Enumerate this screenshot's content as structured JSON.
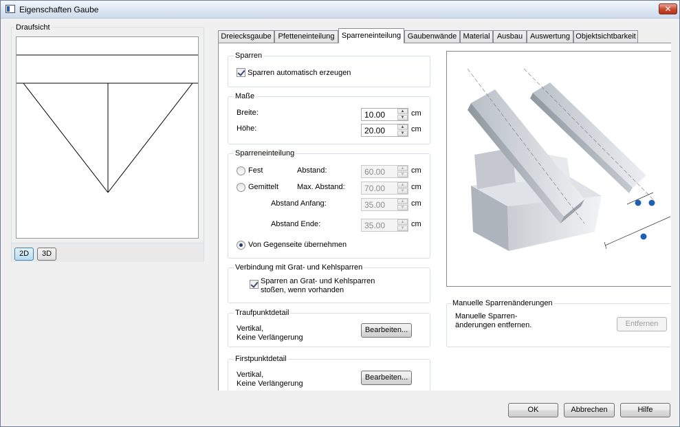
{
  "window": {
    "title": "Eigenschaften Gaube",
    "close_glyph": "✕"
  },
  "left": {
    "group_label": "Draufsicht",
    "btn_2d": "2D",
    "btn_3d": "3D"
  },
  "tabs": [
    {
      "label": "Dreiecksgaube"
    },
    {
      "label": "Pfetteneinteilung"
    },
    {
      "label": "Sparreneinteilung"
    },
    {
      "label": "Gaubenwände"
    },
    {
      "label": "Material"
    },
    {
      "label": "Ausbau"
    },
    {
      "label": "Auswertung"
    },
    {
      "label": "Objektsichtbarkeit"
    }
  ],
  "sparren": {
    "group_label": "Sparren",
    "auto_label": "Sparren automatisch erzeugen",
    "auto_checked": true
  },
  "masse": {
    "group_label": "Maße",
    "breite_label": "Breite:",
    "breite_value": "10.00",
    "hoehe_label": "Höhe:",
    "hoehe_value": "20.00",
    "unit": "cm"
  },
  "einteilung": {
    "group_label": "Sparreneinteilung",
    "fest_label": "Fest",
    "gemittelt_label": "Gemittelt",
    "abstand_label": "Abstand:",
    "abstand_value": "60.00",
    "max_abstand_label": "Max. Abstand:",
    "max_abstand_value": "70.00",
    "abstand_anfang_label": "Abstand Anfang:",
    "abstand_anfang_value": "35.00",
    "abstand_ende_label": "Abstand Ende:",
    "abstand_ende_value": "35.00",
    "gegenseite_label": "Von Gegenseite übernehmen",
    "selected": "gegenseite",
    "unit": "cm"
  },
  "verbindung": {
    "group_label": "Verbindung mit Grat- und Kehlsparren",
    "check_line1": "Sparren an Grat- und Kehlsparren",
    "check_line2": "stoßen, wenn vorhanden",
    "checked": true
  },
  "traufpunkt": {
    "group_label": "Traufpunktdetail",
    "line1": "Vertikal,",
    "line2": "Keine Verlängerung",
    "button": "Bearbeiten..."
  },
  "firstpunkt": {
    "group_label": "Firstpunktdetail",
    "line1": "Vertikal,",
    "line2": "Keine Verlängerung",
    "button": "Bearbeiten..."
  },
  "manual": {
    "group_label": "Manuelle Sparrenänderungen",
    "line1": "Manuelle Sparren-",
    "line2": "änderungen entfernen.",
    "button": "Entfernen"
  },
  "footer": {
    "ok": "OK",
    "cancel": "Abbrechen",
    "help": "Hilfe"
  },
  "colors": {
    "accent_marker": "#1f5fb0",
    "close_red": "#c9462c"
  }
}
